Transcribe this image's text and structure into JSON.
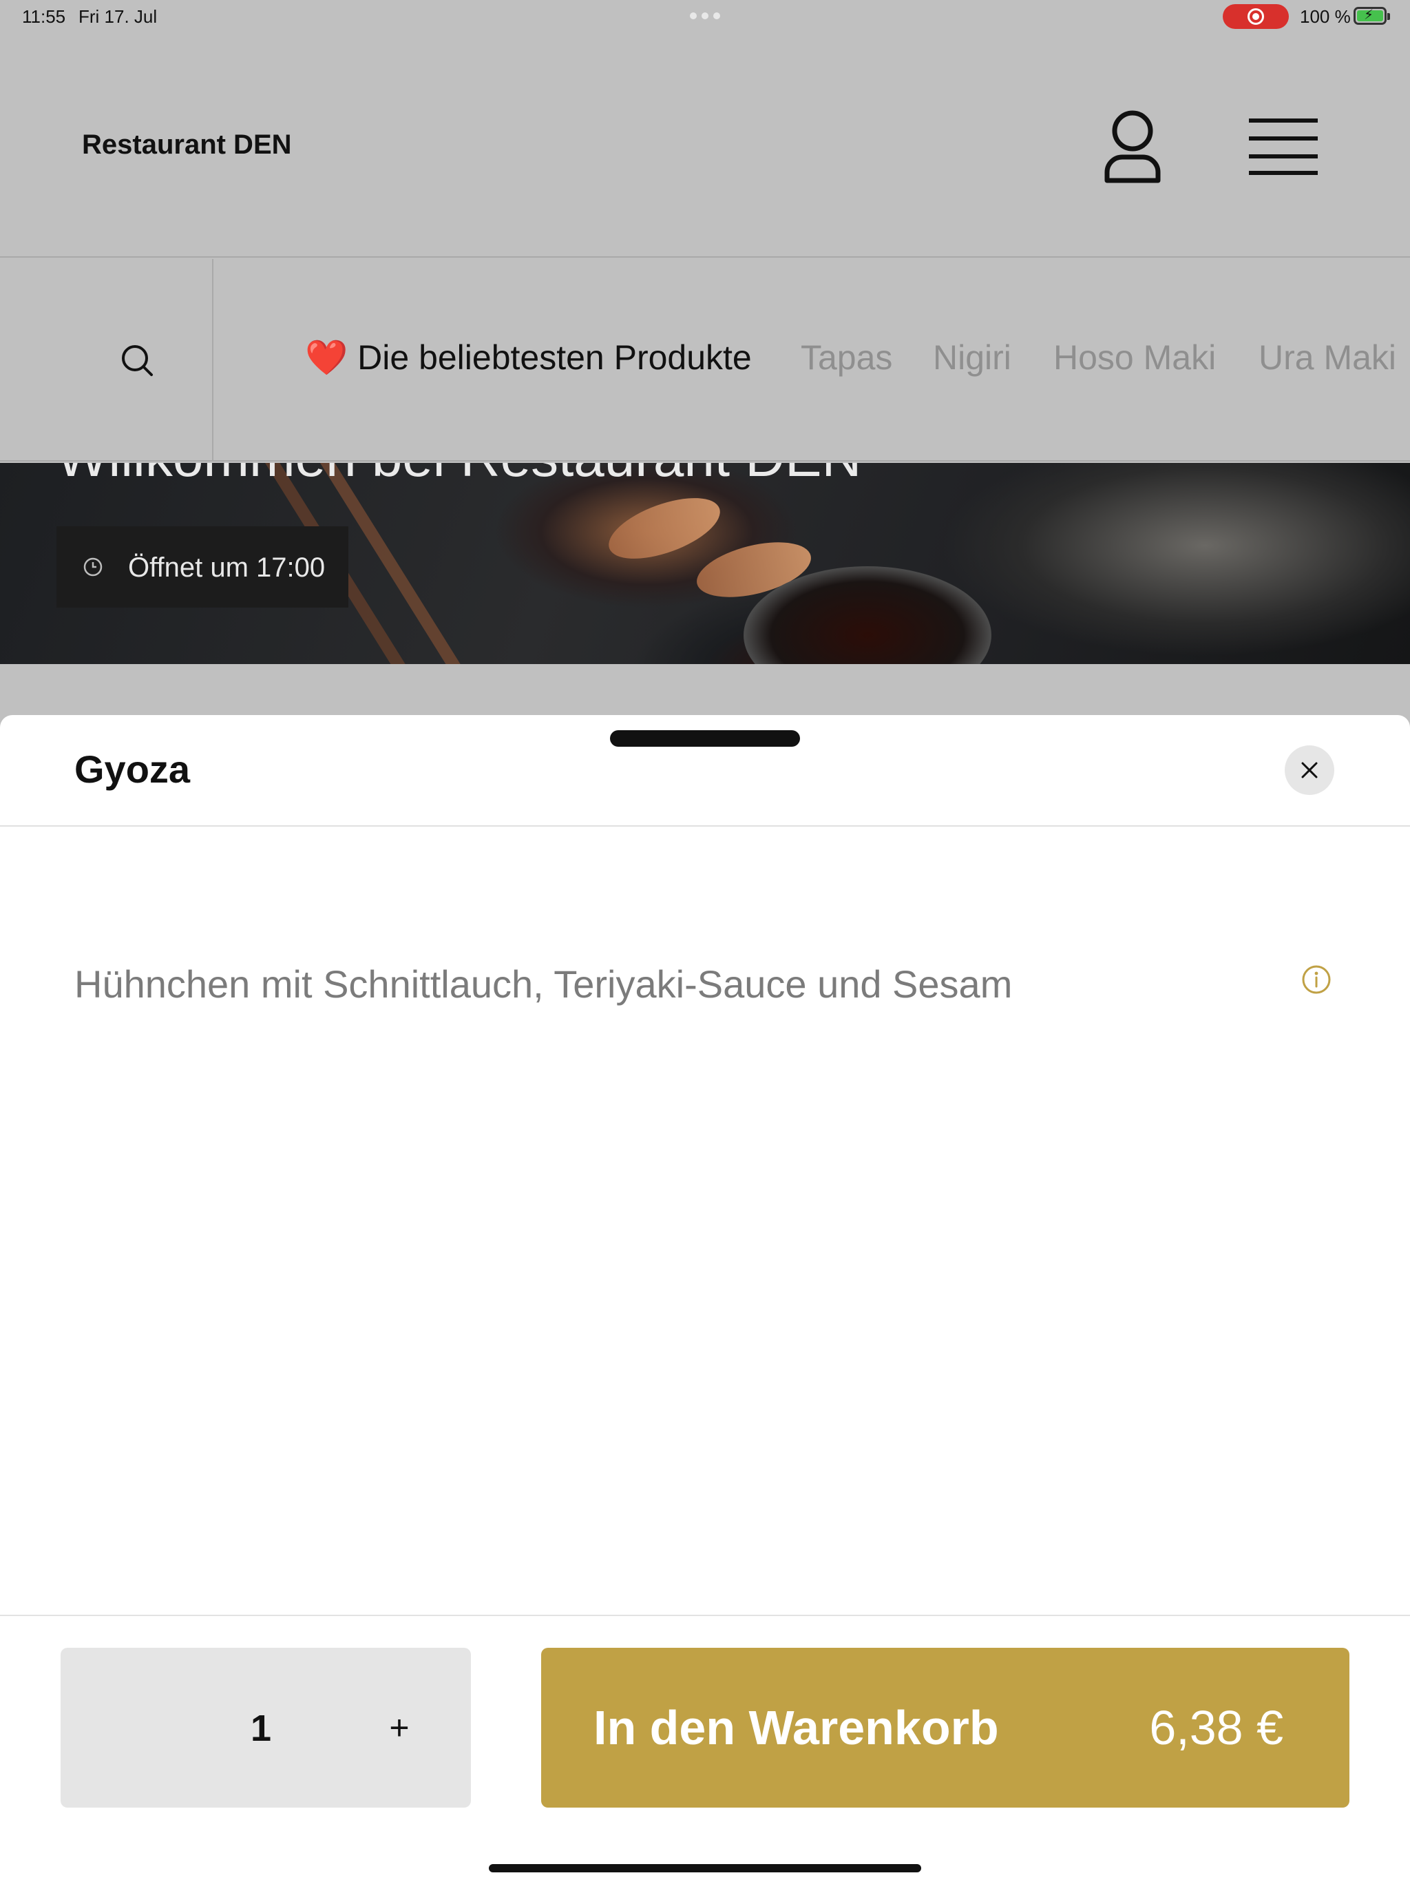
{
  "status_bar": {
    "time": "11:55",
    "date": "Fri 17. Jul",
    "battery_text": "100 %",
    "record_color": "#d8302c",
    "battery_color": "#46c14d"
  },
  "header": {
    "brand": "Restaurant DEN",
    "user_icon": "user-icon",
    "menu_icon": "hamburger-menu-icon"
  },
  "categories": {
    "search_icon": "search-icon",
    "items": [
      {
        "label": "❤️ Die beliebtesten Produkte",
        "active": true
      },
      {
        "label": "Tapas",
        "active": false
      },
      {
        "label": "Nigiri",
        "active": false
      },
      {
        "label": "Hoso Maki",
        "active": false
      },
      {
        "label": "Ura Maki",
        "active": false
      }
    ]
  },
  "hero": {
    "title": "Willkommen bei Restaurant DEN",
    "opening": "Öffnet um 17:00"
  },
  "product_sheet": {
    "title": "Gyoza",
    "description": "Hühnchen mit Schnittlauch, Teriyaki-Sauce und Sesam",
    "quantity": "1",
    "plus_label": "+",
    "add_to_cart_label": "In den Warenkorb",
    "price": "6,38 €",
    "accent_color": "#c0a145"
  }
}
